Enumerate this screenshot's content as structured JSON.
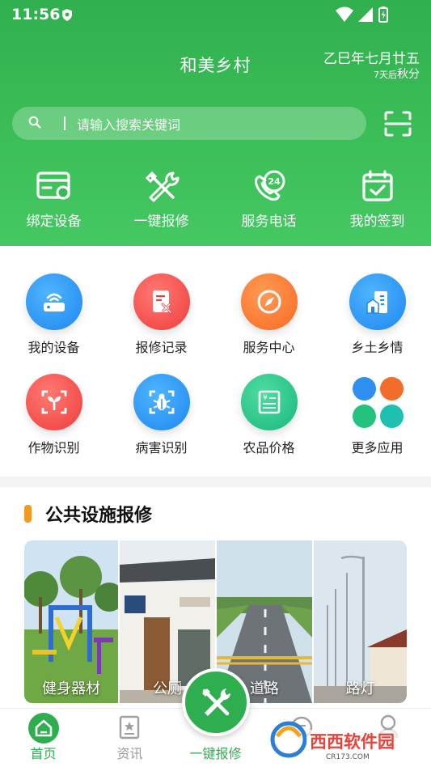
{
  "status": {
    "time": "11:56"
  },
  "header": {
    "title": "和美乡村",
    "lunar_date": "乙巳年七月廿五",
    "solar_term_prefix": "7天后",
    "solar_term": "秋分"
  },
  "search": {
    "placeholder": "请输入搜索关键词"
  },
  "quick_actions": [
    {
      "label": "绑定设备",
      "icon": "card-link-icon"
    },
    {
      "label": "一键报修",
      "icon": "tools-icon"
    },
    {
      "label": "服务电话",
      "icon": "phone-24-icon"
    },
    {
      "label": "我的签到",
      "icon": "calendar-check-icon"
    }
  ],
  "apps": [
    {
      "label": "我的设备",
      "icon": "router-icon",
      "color": "#1e87f0"
    },
    {
      "label": "报修记录",
      "icon": "repair-record-icon",
      "color": "#ef3c3c"
    },
    {
      "label": "服务中心",
      "icon": "compass-icon",
      "color": "#f76a22"
    },
    {
      "label": "乡土乡情",
      "icon": "building-icon",
      "color": "#1e87f0"
    },
    {
      "label": "作物识别",
      "icon": "sprout-scan-icon",
      "color": "#ef3c3c"
    },
    {
      "label": "病害识别",
      "icon": "bug-scan-icon",
      "color": "#1e87f0"
    },
    {
      "label": "农品价格",
      "icon": "price-list-icon",
      "color": "#18b880"
    },
    {
      "label": "更多应用",
      "icon": "more-apps-icon",
      "color": "#f76a22"
    }
  ],
  "repair_section": {
    "title": "公共设施报修",
    "accent": "#f29a1f",
    "items": [
      {
        "label": "健身器材"
      },
      {
        "label": "公厕"
      },
      {
        "label": "道路"
      },
      {
        "label": "路灯"
      }
    ]
  },
  "nav": {
    "items": [
      {
        "label": "首页",
        "icon": "home-icon",
        "active": true
      },
      {
        "label": "资讯",
        "icon": "news-icon",
        "active": false
      },
      {
        "label": "一键报修",
        "icon": "tools-icon",
        "active": false
      },
      {
        "label": "",
        "icon": "message-icon",
        "active": false
      },
      {
        "label": "",
        "icon": "profile-icon",
        "active": false
      }
    ],
    "active_color": "#2eae4f",
    "inactive_color": "#9a9a9a"
  },
  "watermark": {
    "brand": "西西软件园",
    "domain": "CR173.COM"
  }
}
